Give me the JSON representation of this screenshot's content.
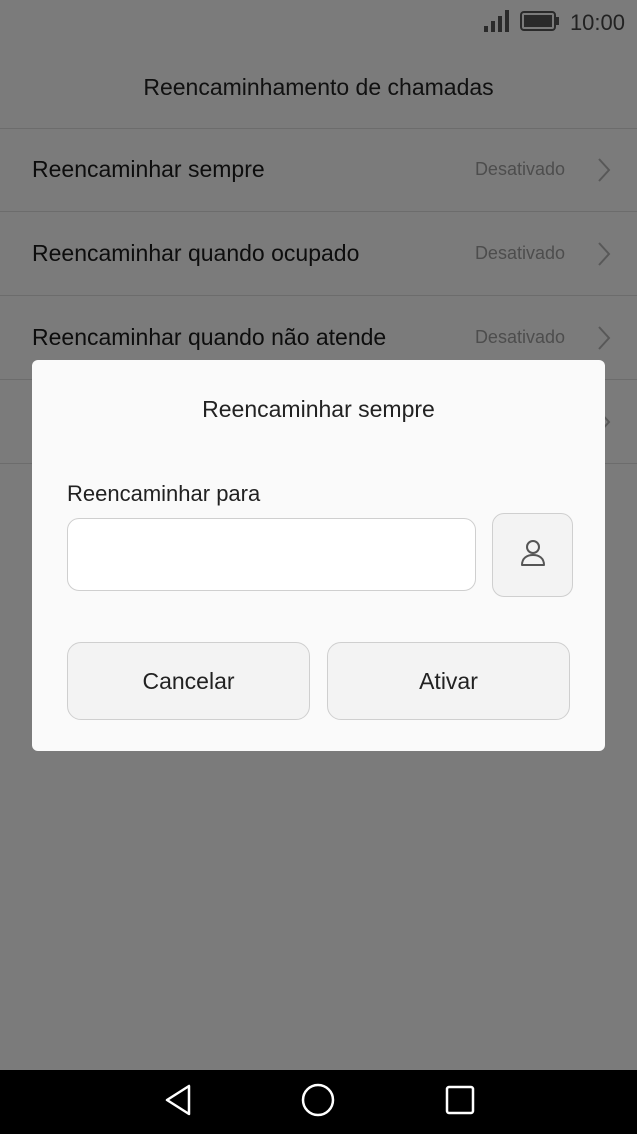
{
  "status_bar": {
    "time": "10:00",
    "signal_icon": "signal-bars-icon",
    "battery_icon": "battery-full-icon"
  },
  "header": {
    "title": "Reencaminhamento de chamadas"
  },
  "list": {
    "items": [
      {
        "label": "Reencaminhar sempre",
        "value": "Desativado"
      },
      {
        "label": "Reencaminhar quando ocupado",
        "value": "Desativado"
      },
      {
        "label": "Reencaminhar quando não atende",
        "value": "Desativado"
      },
      {
        "label": "",
        "value": ""
      }
    ],
    "chevron_icon": "chevron-right-icon"
  },
  "dialog": {
    "title": "Reencaminhar sempre",
    "field_label": "Reencaminhar para",
    "field_value": "",
    "field_placeholder": "",
    "contact_icon": "contact-person-icon",
    "cancel_label": "Cancelar",
    "activate_label": "Ativar"
  },
  "nav_bar": {
    "back_icon": "back-triangle-icon",
    "home_icon": "home-circle-icon",
    "recents_icon": "recents-square-icon"
  },
  "colors": {
    "background": "#f7f7f7",
    "dialog": "#fafafa",
    "nav_bar": "#000000",
    "secondary_text": "#9a9a9a"
  }
}
